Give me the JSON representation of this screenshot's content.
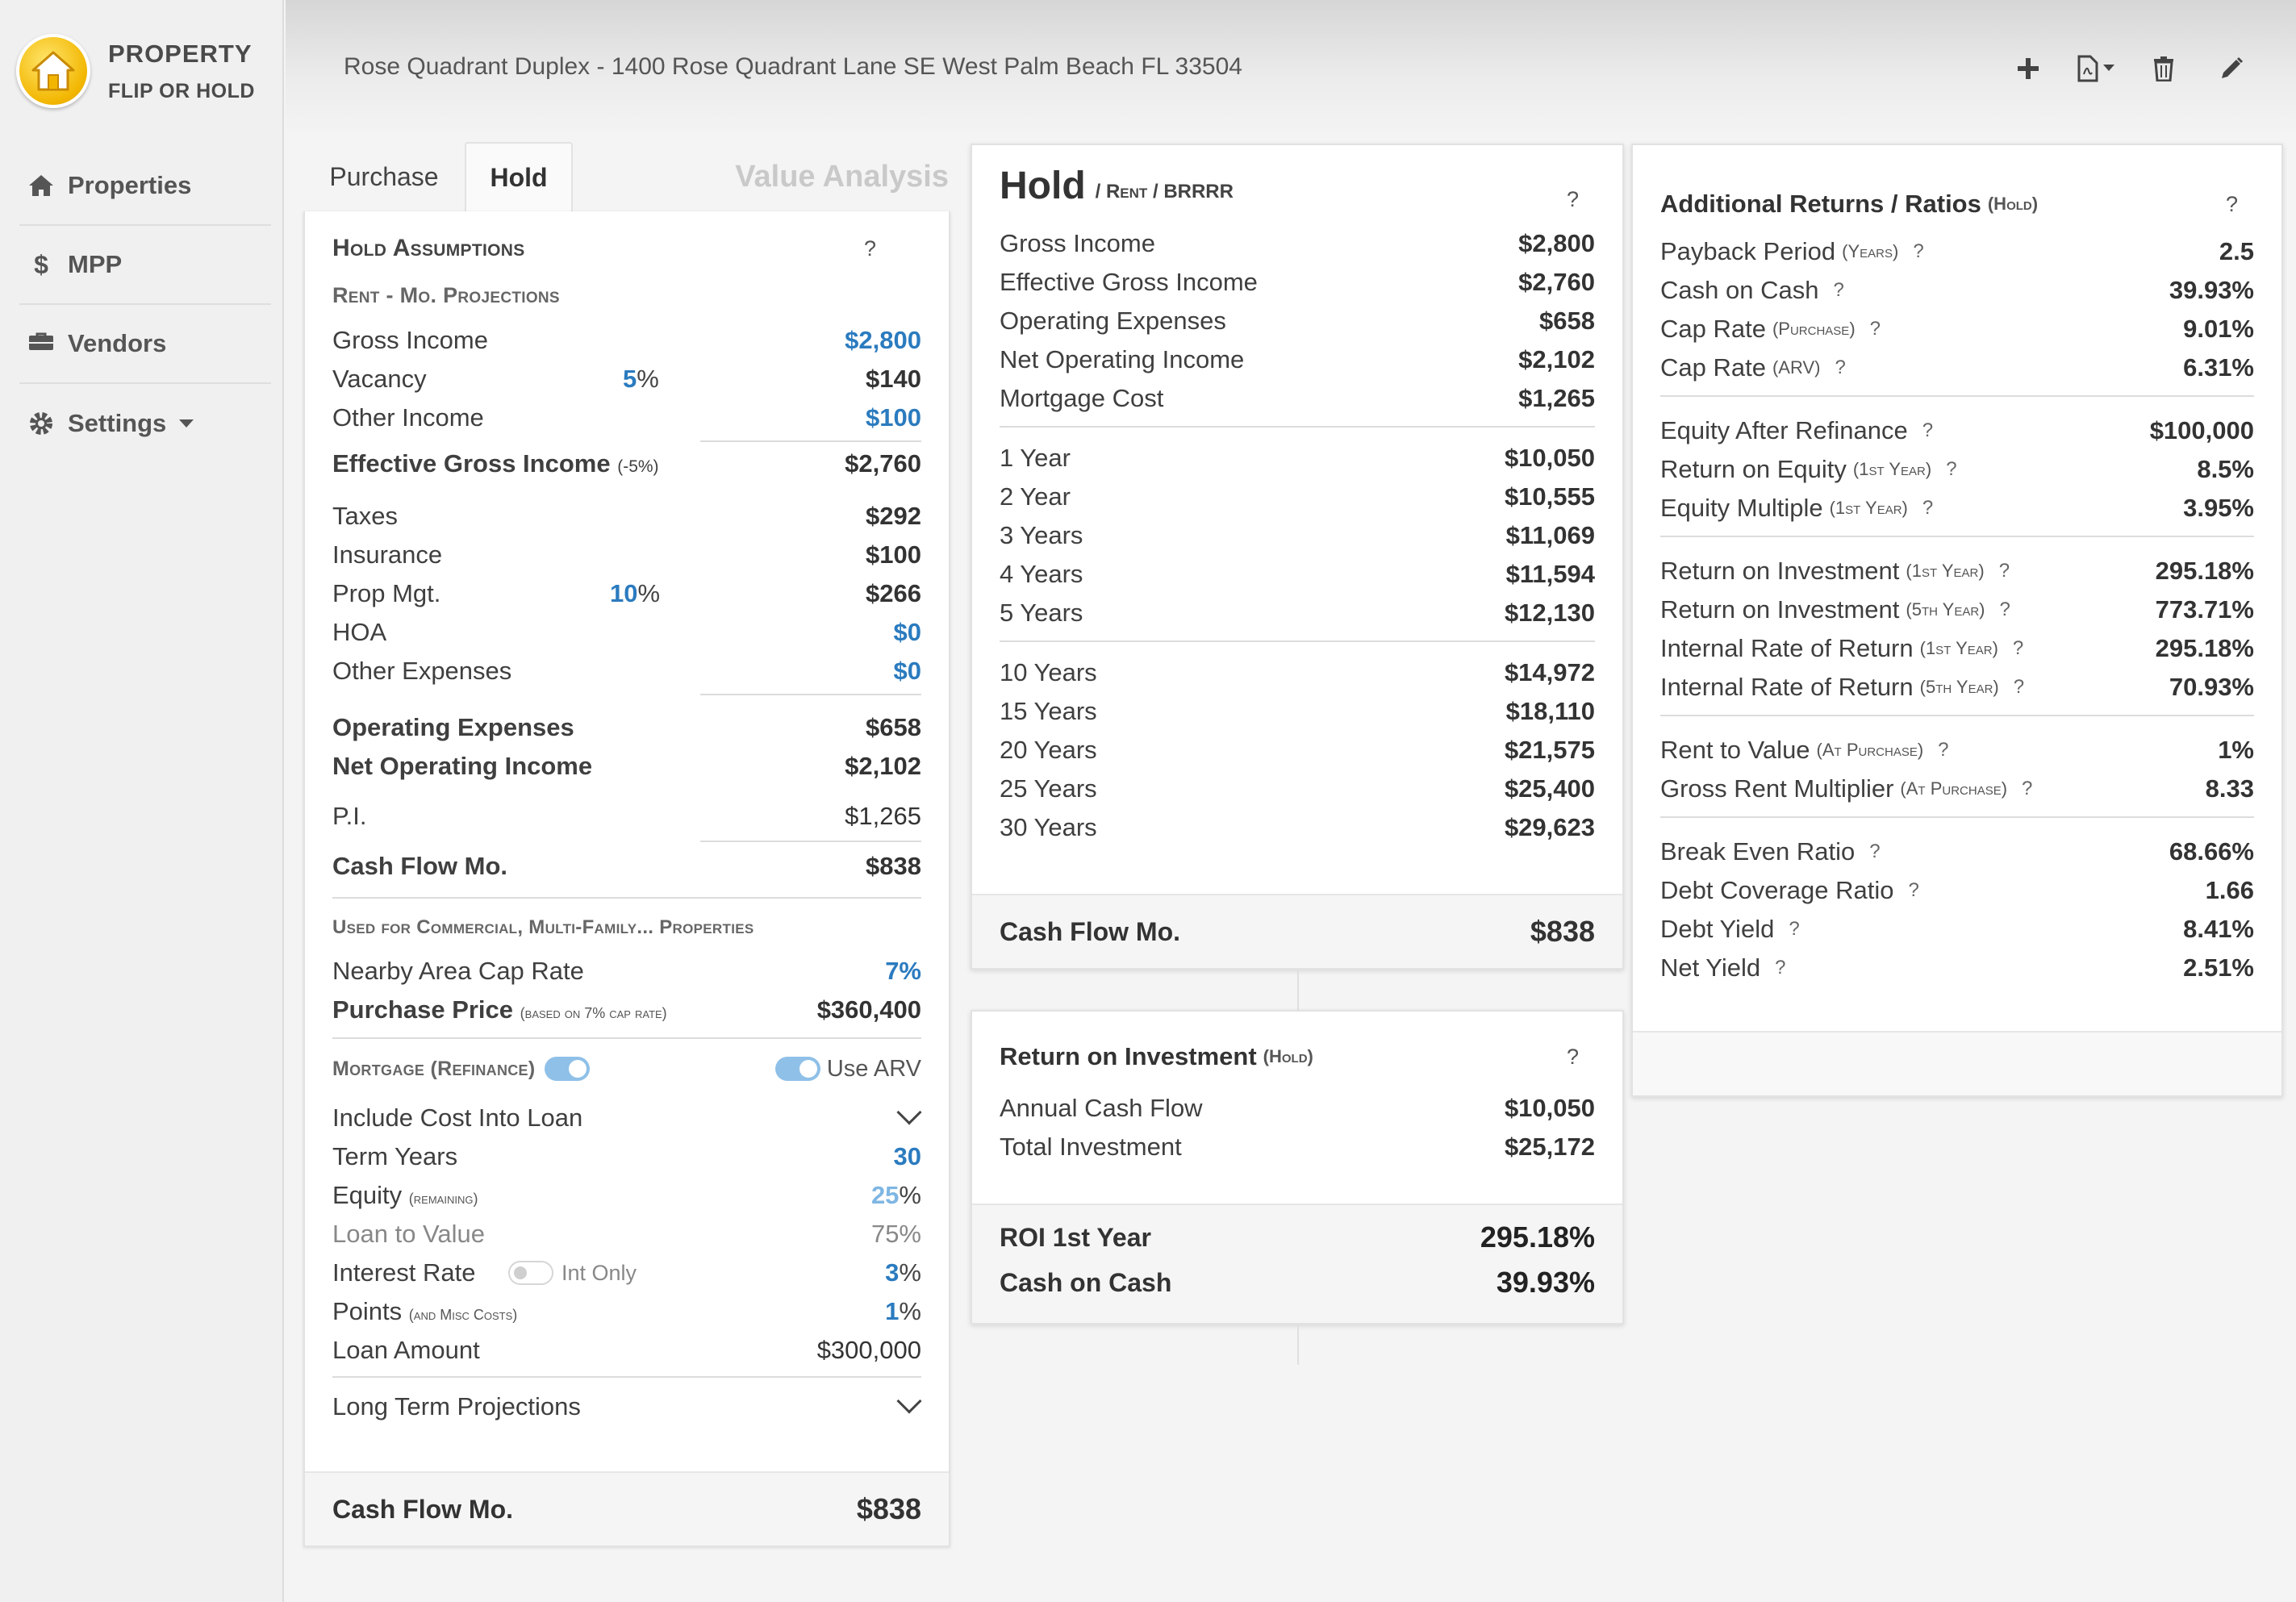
{
  "brand": {
    "line1": "PROPERTY",
    "line2": "FLIP OR HOLD"
  },
  "nav": {
    "properties": "Properties",
    "mpp": "MPP",
    "vendors": "Vendors",
    "settings": "Settings"
  },
  "header": {
    "title": "Rose Quadrant Duplex - 1400 Rose Quadrant Lane SE West Palm Beach FL 33504"
  },
  "tabs": {
    "purchase": "Purchase",
    "hold": "Hold",
    "value_analysis": "Value Analysis"
  },
  "assumptions": {
    "title": "Hold Assumptions",
    "help": "?",
    "rent_section": "Rent - Mo. Projections",
    "gross_income": {
      "label": "Gross Income",
      "value": "$2,800"
    },
    "vacancy": {
      "label": "Vacancy",
      "pct": "5",
      "pct_sign": "%",
      "value": "$140"
    },
    "other_income": {
      "label": "Other Income",
      "value": "$100"
    },
    "egi": {
      "label": "Effective Gross Income",
      "note": "(-5%)",
      "value": "$2,760"
    },
    "taxes": {
      "label": "Taxes",
      "value": "$292"
    },
    "insurance": {
      "label": "Insurance",
      "value": "$100"
    },
    "prop_mgt": {
      "label": "Prop Mgt.",
      "pct": "10",
      "pct_sign": "%",
      "value": "$266"
    },
    "hoa": {
      "label": "HOA",
      "value": "$0"
    },
    "other_expenses": {
      "label": "Other Expenses",
      "value": "$0"
    },
    "operating_expenses": {
      "label": "Operating Expenses",
      "value": "$658"
    },
    "noi": {
      "label": "Net Operating Income",
      "value": "$2,102"
    },
    "pi": {
      "label": "P.I.",
      "value": "$1,265"
    },
    "cash_flow": {
      "label": "Cash Flow Mo.",
      "value": "$838"
    },
    "commercial_section": "Used for Commercial, Multi-Family... Properties",
    "cap_rate": {
      "label": "Nearby Area Cap Rate",
      "value": "7%"
    },
    "purchase_price": {
      "label": "Purchase Price",
      "note": "(based on 7% cap rate)",
      "value": "$360,400"
    },
    "mortgage_section": "Mortgage (Refinance)",
    "use_arv": "Use ARV",
    "include_cost": {
      "label": "Include Cost Into Loan"
    },
    "term_years": {
      "label": "Term Years",
      "value": "30"
    },
    "equity": {
      "label": "Equity",
      "note": "(remaining)",
      "value": "25",
      "sign": "%"
    },
    "ltv": {
      "label": "Loan to Value",
      "value": "75%"
    },
    "interest_rate": {
      "label": "Interest Rate",
      "int_only": "Int Only",
      "value": "3",
      "sign": "%"
    },
    "points": {
      "label": "Points",
      "note": "(and Misc Costs)",
      "value": "1",
      "sign": "%"
    },
    "loan_amount": {
      "label": "Loan Amount",
      "value": "$300,000"
    },
    "long_term": {
      "label": "Long Term Projections"
    },
    "footer": {
      "label": "Cash Flow Mo.",
      "value": "$838"
    }
  },
  "hold": {
    "title": "Hold",
    "subtitle": "/ Rent / BRRRR",
    "help": "?",
    "summary": [
      {
        "label": "Gross Income",
        "value": "$2,800"
      },
      {
        "label": "Effective Gross Income",
        "value": "$2,760"
      },
      {
        "label": "Operating Expenses",
        "value": "$658"
      },
      {
        "label": "Net Operating Income",
        "value": "$2,102"
      },
      {
        "label": "Mortgage Cost",
        "value": "$1,265"
      }
    ],
    "short_term": [
      {
        "label": "1 Year",
        "value": "$10,050"
      },
      {
        "label": "2 Year",
        "value": "$10,555"
      },
      {
        "label": "3 Years",
        "value": "$11,069"
      },
      {
        "label": "4 Years",
        "value": "$11,594"
      },
      {
        "label": "5 Years",
        "value": "$12,130"
      }
    ],
    "long_term": [
      {
        "label": "10 Years",
        "value": "$14,972"
      },
      {
        "label": "15 Years",
        "value": "$18,110"
      },
      {
        "label": "20 Years",
        "value": "$21,575"
      },
      {
        "label": "25 Years",
        "value": "$25,400"
      },
      {
        "label": "30 Years",
        "value": "$29,623"
      }
    ],
    "footer": {
      "label": "Cash Flow Mo.",
      "value": "$838"
    }
  },
  "roi": {
    "title": "Return on Investment",
    "title_note": "(Hold)",
    "help": "?",
    "annual_cash_flow": {
      "label": "Annual Cash Flow",
      "value": "$10,050"
    },
    "total_investment": {
      "label": "Total Investment",
      "value": "$25,172"
    },
    "roi_1st_year": {
      "label": "ROI 1st Year",
      "value": "295.18%"
    },
    "cash_on_cash": {
      "label": "Cash on Cash",
      "value": "39.93%"
    }
  },
  "additional": {
    "title": "Additional Returns / Ratios",
    "title_note": "(Hold)",
    "help": "?",
    "groups": [
      [
        {
          "label": "Payback Period",
          "note": "(Years)",
          "value": "2.5"
        },
        {
          "label": "Cash on Cash",
          "note": "",
          "value": "39.93%"
        },
        {
          "label": "Cap Rate",
          "note": "(Purchase)",
          "value": "9.01%"
        },
        {
          "label": "Cap Rate",
          "note": "(ARV)",
          "value": "6.31%"
        }
      ],
      [
        {
          "label": "Equity After Refinance",
          "note": "",
          "value": "$100,000"
        },
        {
          "label": "Return on Equity",
          "note": "(1st Year)",
          "value": "8.5%"
        },
        {
          "label": "Equity Multiple",
          "note": "(1st Year)",
          "value": "3.95%"
        }
      ],
      [
        {
          "label": "Return on Investment",
          "note": "(1st Year)",
          "value": "295.18%"
        },
        {
          "label": "Return on Investment",
          "note": "(5th Year)",
          "value": "773.71%"
        },
        {
          "label": "Internal Rate of Return",
          "note": "(1st Year)",
          "value": "295.18%"
        },
        {
          "label": "Internal Rate of Return",
          "note": "(5th Year)",
          "value": "70.93%"
        }
      ],
      [
        {
          "label": "Rent to Value",
          "note": "(At Purchase)",
          "value": "1%"
        },
        {
          "label": "Gross Rent Multiplier",
          "note": "(At Purchase)",
          "value": "8.33"
        }
      ],
      [
        {
          "label": "Break Even Ratio",
          "note": "",
          "value": "68.66%"
        },
        {
          "label": "Debt Coverage Ratio",
          "note": "",
          "value": "1.66"
        },
        {
          "label": "Debt Yield",
          "note": "",
          "value": "8.41%"
        },
        {
          "label": "Net Yield",
          "note": "",
          "value": "2.51%"
        }
      ]
    ]
  },
  "icons": {
    "add": "plus-icon",
    "pdf": "pdf-icon",
    "delete": "trash-icon",
    "edit": "pencil-icon",
    "home": "home-icon",
    "dollar": "dollar-icon",
    "truck": "truck-icon",
    "gear": "gear-icon"
  },
  "colors": {
    "accent_blue": "#2b7bbf",
    "logo_yellow": "#f2b600"
  }
}
